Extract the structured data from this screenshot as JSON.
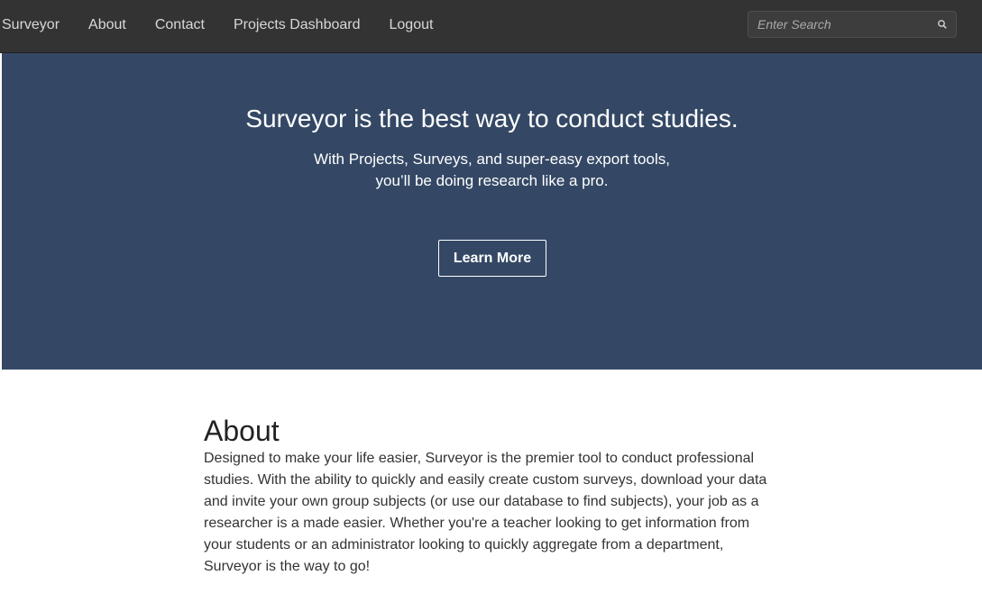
{
  "navbar": {
    "brand": "Surveyor",
    "links": [
      "About",
      "Contact",
      "Projects Dashboard",
      "Logout"
    ],
    "search": {
      "placeholder": "Enter Search",
      "value": ""
    }
  },
  "hero": {
    "title": "Surveyor is the best way to conduct studies.",
    "subtitle": "With Projects, Surveys, and super-easy export tools, you’ll be doing research like a pro.",
    "button_label": "Learn More",
    "background_color": "#344865"
  },
  "about": {
    "heading": "About",
    "body": "Designed to make your life easier, Surveyor is the premier tool to conduct professional studies. With the ability to quickly and easily create custom surveys, download your data and invite your own group subjects (or use our database to find subjects), your job as a researcher is a made easier. Whether you're a teacher looking to get information from your students or an administrator looking to quickly aggregate from a department, Surveyor is the way to go!"
  },
  "icons": {
    "search": "search-icon"
  }
}
